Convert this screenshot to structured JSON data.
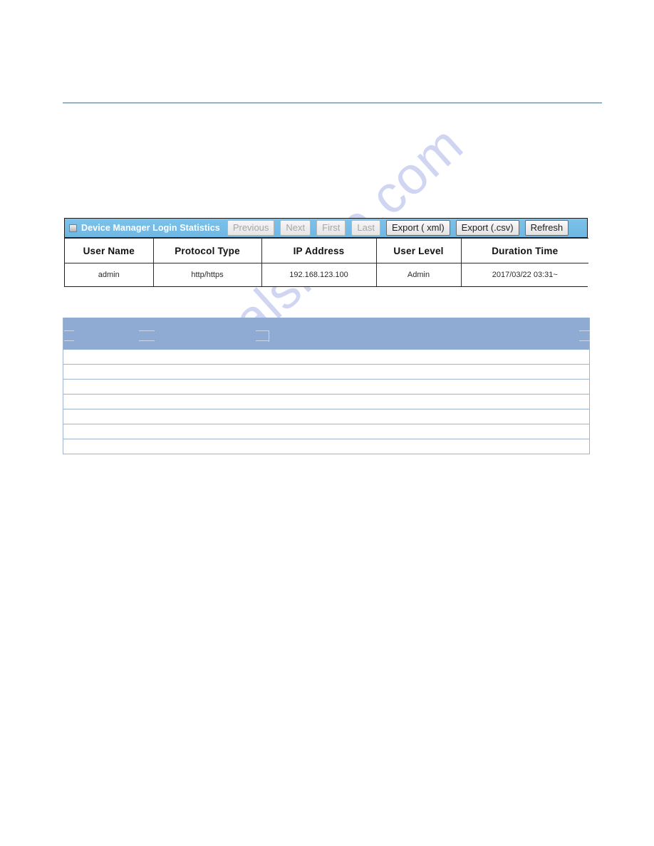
{
  "page": {
    "background_color": "#ffffff",
    "header_rule_color": "#4b6f8c"
  },
  "watermark": {
    "text": "manualshive.com",
    "color": "#bfc5ee"
  },
  "panel": {
    "icon": "window-icon",
    "title": "Device Manager Login Statistics",
    "titlebar_color": "#76bde8",
    "buttons": [
      {
        "label": "Previous",
        "name": "previous-button",
        "disabled": true
      },
      {
        "label": "Next",
        "name": "next-button",
        "disabled": true
      },
      {
        "label": "First",
        "name": "first-button",
        "disabled": true
      },
      {
        "label": "Last",
        "name": "last-button",
        "disabled": true
      },
      {
        "label": "Export ( xml)",
        "name": "export-xml-button",
        "disabled": false
      },
      {
        "label": "Export (.csv)",
        "name": "export-csv-button",
        "disabled": false
      },
      {
        "label": "Refresh",
        "name": "refresh-button",
        "disabled": false
      }
    ],
    "table": {
      "columns": [
        "User Name",
        "Protocol Type",
        "IP Address",
        "User Level",
        "Duration Time"
      ],
      "rows": [
        [
          "admin",
          "http/https",
          "192.168.123.100",
          "Admin",
          "2017/03/22 03:31~"
        ]
      ]
    }
  },
  "blank_table": {
    "header_color": "#8fabd3",
    "border_color": "#9eb4cf",
    "header_cells": [
      "",
      "",
      "",
      ""
    ],
    "rows": [
      [
        "",
        "",
        "",
        ""
      ],
      [
        "",
        "",
        "",
        ""
      ],
      [
        "",
        "",
        "",
        ""
      ],
      [
        "",
        "",
        "",
        ""
      ],
      [
        "",
        "",
        "",
        ""
      ],
      [
        "",
        "",
        "",
        ""
      ],
      [
        "",
        "",
        "",
        ""
      ]
    ]
  }
}
